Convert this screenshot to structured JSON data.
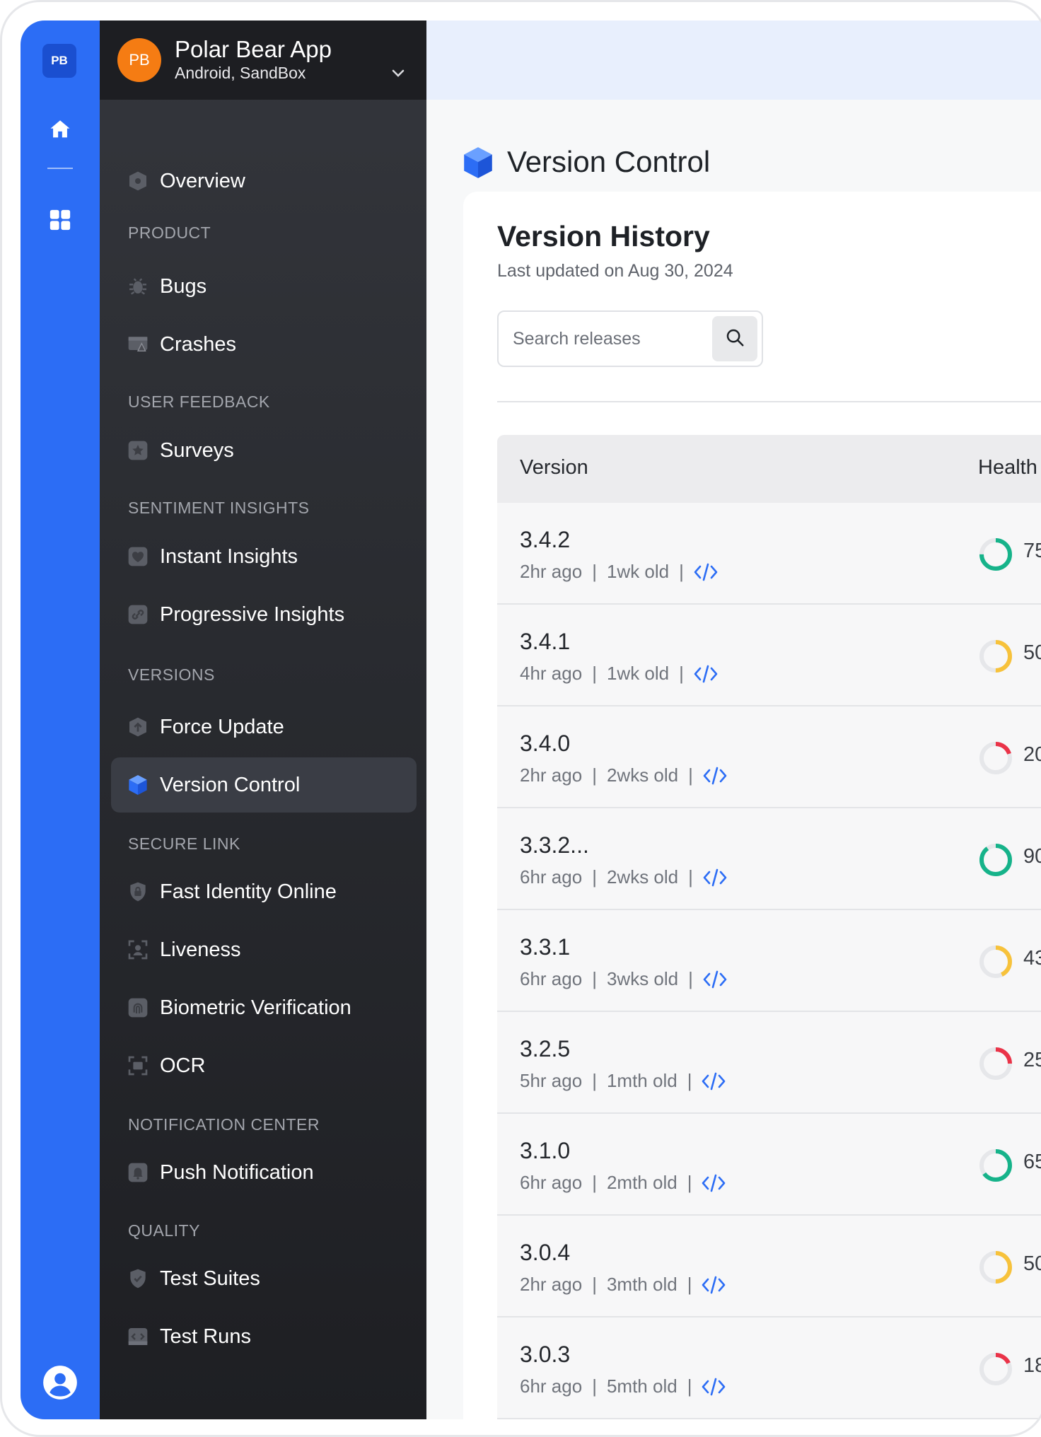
{
  "rail": {
    "badge": "PB",
    "icons": [
      "home-icon",
      "grid-icon",
      "user-avatar-icon"
    ]
  },
  "app": {
    "avatar": "PB",
    "name": "Polar Bear App",
    "subtitle": "Android, SandBox"
  },
  "nav": {
    "overview": "Overview",
    "sections": {
      "product": "PRODUCT",
      "user_feedback": "USER FEEDBACK",
      "sentiment": "SENTIMENT INSIGHTS",
      "versions": "VERSIONS",
      "secure_link": "SECURE LINK",
      "notification": "NOTIFICATION CENTER",
      "quality": "QUALITY"
    },
    "items": {
      "bugs": "Bugs",
      "crashes": "Crashes",
      "surveys": "Surveys",
      "instant_insights": "Instant Insights",
      "progressive_insights": "Progressive Insights",
      "force_update": "Force Update",
      "version_control": "Version Control",
      "fido": "Fast Identity Online",
      "liveness": "Liveness",
      "biometric": "Biometric Verification",
      "ocr": "OCR",
      "push": "Push Notification",
      "test_suites": "Test Suites",
      "test_runs": "Test Runs"
    },
    "active": "version_control"
  },
  "page": {
    "title": "Version Control"
  },
  "card": {
    "title": "Version History",
    "subtitle": "Last updated on Aug 30, 2024",
    "search_placeholder": "Search releases"
  },
  "table": {
    "headers": {
      "version": "Version",
      "health": "Health"
    },
    "rows": [
      {
        "version": "3.4.2",
        "updated": "2hr ago",
        "age": "1wk old",
        "health": 75,
        "health_text": "75",
        "color": "#16b38a"
      },
      {
        "version": "3.4.1",
        "updated": "4hr ago",
        "age": "1wk old",
        "health": 50,
        "health_text": "50",
        "color": "#f7c23b"
      },
      {
        "version": "3.4.0",
        "updated": "2hr ago",
        "age": "2wks old",
        "health": 20,
        "health_text": "20",
        "color": "#ea3348"
      },
      {
        "version": "3.3.2...",
        "updated": "6hr ago",
        "age": "2wks old",
        "health": 90,
        "health_text": "90",
        "color": "#16b38a"
      },
      {
        "version": "3.3.1",
        "updated": "6hr ago",
        "age": "3wks old",
        "health": 43,
        "health_text": "43",
        "color": "#f7c23b"
      },
      {
        "version": "3.2.5",
        "updated": "5hr ago",
        "age": "1mth old",
        "health": 25,
        "health_text": "25",
        "color": "#ea3348"
      },
      {
        "version": "3.1.0",
        "updated": "6hr ago",
        "age": "2mth old",
        "health": 65,
        "health_text": "65",
        "color": "#16b38a"
      },
      {
        "version": "3.0.4",
        "updated": "2hr ago",
        "age": "3mth old",
        "health": 50,
        "health_text": "50",
        "color": "#f7c23b"
      },
      {
        "version": "3.0.3",
        "updated": "6hr ago",
        "age": "5mth old",
        "health": 18,
        "health_text": "18",
        "color": "#ea3348"
      }
    ]
  },
  "colors": {
    "rail": "#2c6df5",
    "accent": "#2c6df5",
    "sidebar": "#2a2c31",
    "avatar": "#f57c13"
  }
}
